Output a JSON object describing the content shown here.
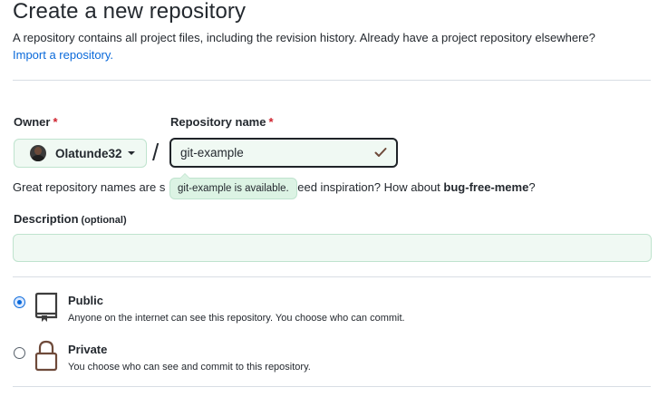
{
  "header": {
    "title": "Create a new repository",
    "subtitle": "A repository contains all project files, including the revision history. Already have a project repository elsewhere?",
    "import_link": "Import a repository."
  },
  "owner": {
    "label": "Owner",
    "required_marker": "*",
    "selected": "Olatunde32"
  },
  "repo_name": {
    "label": "Repository name",
    "required_marker": "*",
    "value": "git-example",
    "separator": "/"
  },
  "availability": {
    "tooltip": "git-example is available.",
    "hint_prefix": "Great repository names are s",
    "hint_middle": "leed inspiration? How about ",
    "suggestion": "bug-free-meme",
    "hint_suffix": "?"
  },
  "description": {
    "label": "Description",
    "optional": "(optional)",
    "value": ""
  },
  "visibility": {
    "options": [
      {
        "title": "Public",
        "description": "Anyone on the internet can see this repository. You choose who can commit.",
        "checked": true,
        "icon": "repo-icon"
      },
      {
        "title": "Private",
        "description": "You choose who can see and commit to this repository.",
        "checked": false,
        "icon": "lock-icon"
      }
    ]
  },
  "colors": {
    "link": "#0969da",
    "required": "#cf222e",
    "success": "#1a7f37",
    "field_bg": "#f0f9f3"
  }
}
